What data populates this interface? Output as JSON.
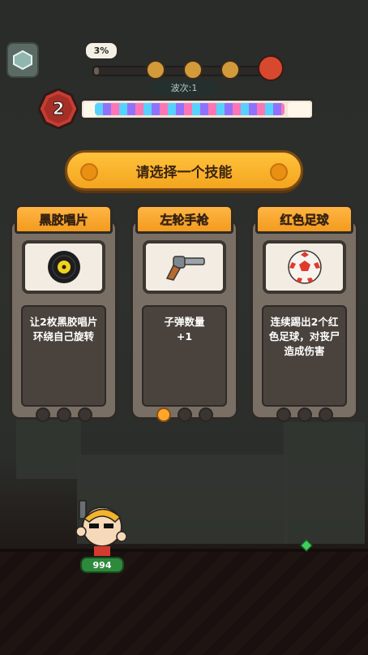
{
  "hud": {
    "progress_percent": "3%",
    "wave_label": "波次:1",
    "level": "2",
    "wave_progress": 0.03
  },
  "banner": {
    "title": "请选择一个技能"
  },
  "cards": [
    {
      "name": "黑胶唱片",
      "icon": "vinyl-record-icon",
      "desc": "让2枚黑胶唱片环绕自己旋转",
      "level_dots": [
        false,
        false,
        false
      ]
    },
    {
      "name": "左轮手枪",
      "icon": "revolver-icon",
      "desc": "子弹数量\n+1",
      "level_dots": [
        true,
        false,
        false
      ]
    },
    {
      "name": "红色足球",
      "icon": "red-soccer-ball-icon",
      "desc": "连续踢出2个红色足球，对丧尸造成伤害",
      "level_dots": [
        false,
        false,
        false
      ]
    }
  ],
  "player": {
    "hp": "994"
  },
  "colors": {
    "accent": "#f4a51f",
    "card_tab": "#ffb544",
    "hp_bar": "#2e8a3b"
  }
}
